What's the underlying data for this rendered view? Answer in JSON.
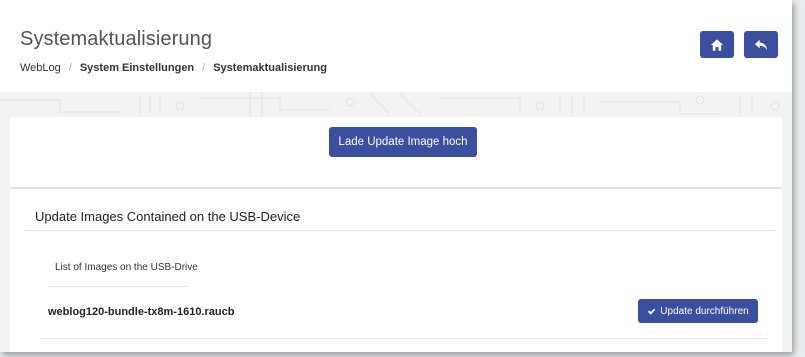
{
  "header": {
    "title": "Systemaktualisierung",
    "breadcrumb": [
      "WebLog",
      "System Einstellungen",
      "Systemaktualisierung"
    ],
    "home_icon": "home-icon",
    "back_icon": "reply-icon"
  },
  "upload": {
    "label": "Lade Update Image hoch"
  },
  "usb_section": {
    "title": "Update Images Contained on the USB-Device",
    "list_header": "List of Images on the USB-Drive",
    "files": [
      {
        "name": "weblog120-bundle-tx8m-1610.raucb",
        "action_label": "Update durchführen",
        "action_icon": "check-icon"
      }
    ]
  },
  "colors": {
    "accent": "#3b4fa0",
    "background": "#ffffff"
  }
}
